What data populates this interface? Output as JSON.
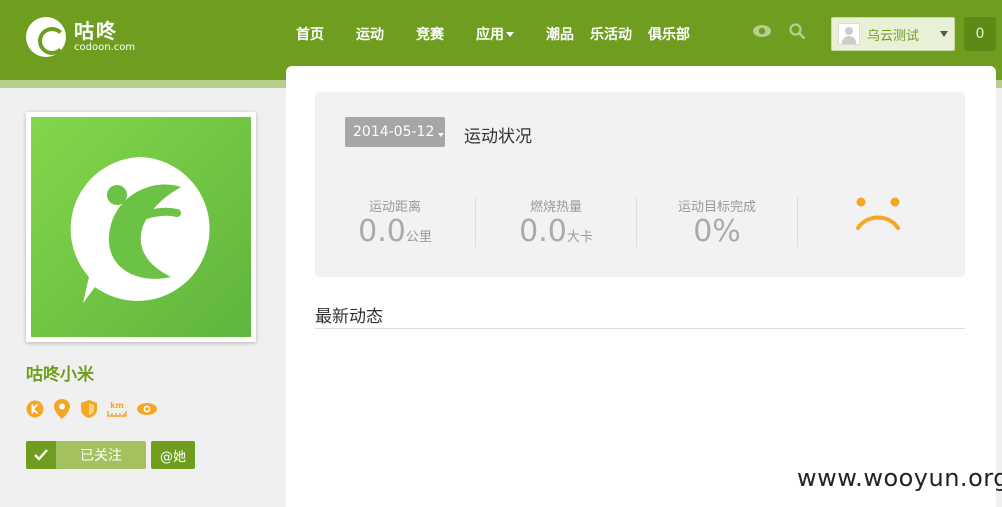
{
  "header": {
    "logo_cn": "咕咚",
    "logo_en": "codoon.com",
    "nav": [
      {
        "label": "首页",
        "caret": false
      },
      {
        "label": "运动",
        "caret": false
      },
      {
        "label": "竞赛",
        "caret": false
      },
      {
        "label": "应用",
        "caret": true
      },
      {
        "label": "潮品",
        "caret": false
      },
      {
        "label": "乐活动",
        "caret": false
      },
      {
        "label": "俱乐部",
        "caret": false
      }
    ],
    "user_name": "乌云测试",
    "message_count": "0"
  },
  "profile": {
    "name": "咕咚小米",
    "follow_label": "已关注",
    "at_label": "@她",
    "badge_km": "km"
  },
  "status": {
    "date": "2014-05-12",
    "title": "运动状况",
    "stats": [
      {
        "label": "运动距离",
        "value": "0.0",
        "unit": "公里"
      },
      {
        "label": "燃烧热量",
        "value": "0.0",
        "unit": "大卡"
      },
      {
        "label": "运动目标完成",
        "value": "0%",
        "unit": ""
      }
    ]
  },
  "feed": {
    "title": "最新动态"
  },
  "watermark": "www.wooyun.org",
  "colors": {
    "brand_green": "#6f9d1f",
    "light_green": "#a3c15e",
    "accent_orange": "#f5a623"
  }
}
